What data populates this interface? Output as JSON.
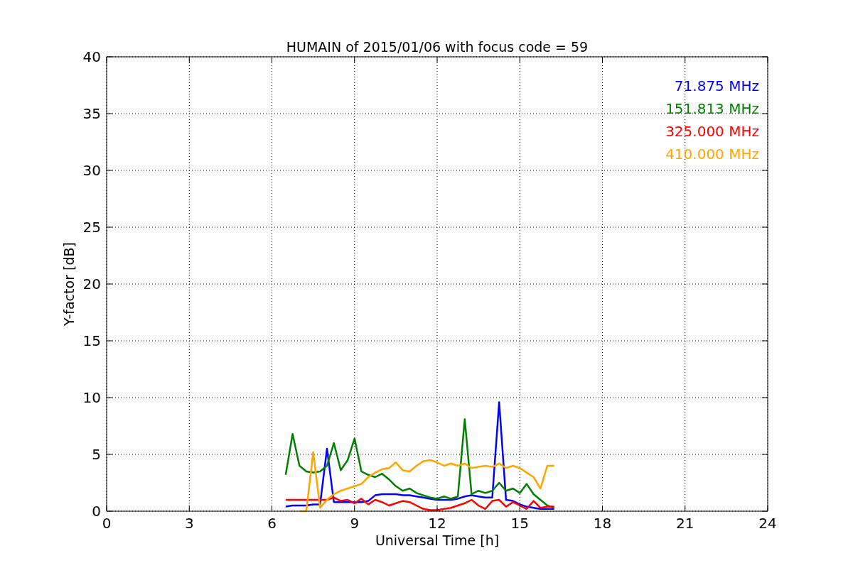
{
  "chart_data": {
    "type": "line",
    "title": "HUMAIN of 2015/01/06 with focus code = 59",
    "xlabel": "Universal Time [h]",
    "ylabel": "Y-factor [dB]",
    "x": [
      6.5,
      6.75,
      7,
      7.25,
      7.5,
      7.75,
      8,
      8.25,
      8.5,
      8.75,
      9,
      9.25,
      9.5,
      9.75,
      10,
      10.25,
      10.5,
      10.75,
      11,
      11.25,
      11.5,
      11.75,
      12,
      12.25,
      12.5,
      12.75,
      13,
      13.25,
      13.5,
      13.75,
      14,
      14.25,
      14.5,
      14.75,
      15,
      15.25,
      15.5,
      15.75,
      16,
      16.25
    ],
    "series": [
      {
        "name": "71.875 MHz",
        "color": "#0000ff",
        "values": [
          0.4,
          0.5,
          0.5,
          0.5,
          0.6,
          0.6,
          5.5,
          0.8,
          0.8,
          0.8,
          0.8,
          0.8,
          0.9,
          1.4,
          1.5,
          1.5,
          1.5,
          1.4,
          1.4,
          1.3,
          1.2,
          1.1,
          1.0,
          1.0,
          1.0,
          1.1,
          1.3,
          1.4,
          1.3,
          1.2,
          1.2,
          9.6,
          1.0,
          0.9,
          0.6,
          0.4,
          0.3,
          0.2,
          0.2,
          0.2
        ]
      },
      {
        "name": "151.813 MHz",
        "color": "#008000",
        "values": [
          3.2,
          6.8,
          4.0,
          3.5,
          3.4,
          3.5,
          4.0,
          6.0,
          3.6,
          4.5,
          6.4,
          3.5,
          3.2,
          3.0,
          3.3,
          2.8,
          2.2,
          1.8,
          2.0,
          1.6,
          1.4,
          1.2,
          1.1,
          1.3,
          1.1,
          1.3,
          8.1,
          1.5,
          1.8,
          1.6,
          1.8,
          2.5,
          1.8,
          2.0,
          1.6,
          2.4,
          1.5,
          1.0,
          0.5,
          0.3
        ]
      },
      {
        "name": "325.000 MHz",
        "color": "#ff0000",
        "values": [
          1.0,
          1.0,
          1.0,
          1.0,
          1.0,
          1.0,
          1.0,
          1.2,
          0.9,
          1.0,
          0.7,
          1.1,
          0.6,
          1.0,
          0.8,
          0.5,
          0.7,
          0.9,
          0.8,
          0.5,
          0.2,
          0.1,
          0.1,
          0.2,
          0.3,
          0.5,
          0.7,
          1.0,
          0.5,
          0.2,
          0.9,
          1.0,
          0.4,
          0.8,
          0.5,
          0.2,
          0.9,
          0.3,
          0.4,
          0.4
        ]
      },
      {
        "name": "410.000 MHz",
        "color": "#ffa500",
        "values": [
          null,
          null,
          0.0,
          0.0,
          5.2,
          0.3,
          1.0,
          1.5,
          1.8,
          2.0,
          2.2,
          2.4,
          3.0,
          3.4,
          3.7,
          3.8,
          4.3,
          3.6,
          3.5,
          4.0,
          4.4,
          4.5,
          4.3,
          4.0,
          4.2,
          4.0,
          4.2,
          3.8,
          3.9,
          4.0,
          3.9,
          4.2,
          3.8,
          4.0,
          3.8,
          3.4,
          3.0,
          2.0,
          4.0,
          4.0
        ]
      }
    ],
    "xlim": [
      0,
      24
    ],
    "ylim": [
      0,
      40
    ],
    "xticks": [
      0,
      3,
      6,
      9,
      12,
      15,
      18,
      21,
      24
    ],
    "yticks": [
      0,
      5,
      10,
      15,
      20,
      25,
      30,
      35,
      40
    ],
    "grid": true
  }
}
